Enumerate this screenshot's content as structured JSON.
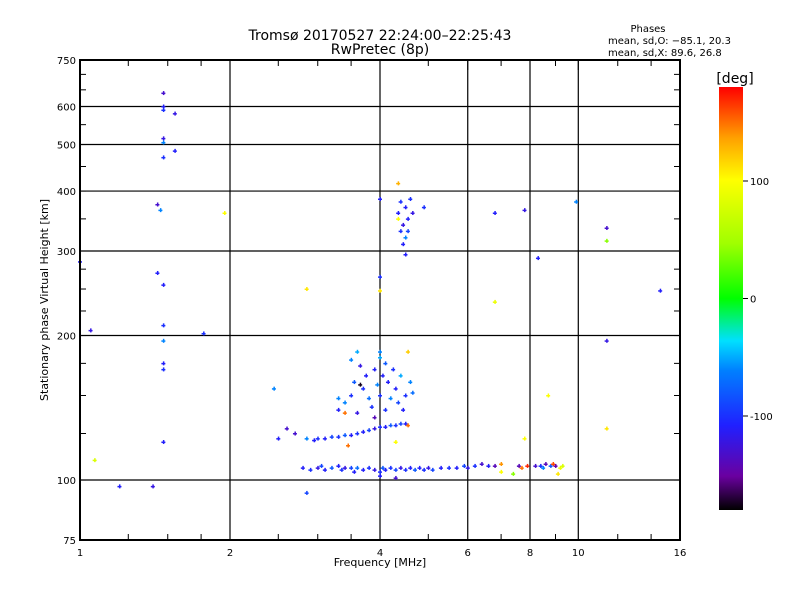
{
  "chart_data": {
    "type": "scatter",
    "title": "Tromsø 20170527 22:24:00–22:25:43",
    "subtitle": "RwPretec (8p)",
    "xlabel": "Frequency [MHz]",
    "ylabel": "Stationary phase Virtual Height [km]",
    "xscale": "log",
    "yscale": "log",
    "xlim": [
      1,
      16
    ],
    "ylim": [
      75,
      750
    ],
    "xticks": [
      1,
      2,
      4,
      6,
      8,
      10,
      16
    ],
    "xtick_labels": [
      "1",
      "2",
      "4",
      "6",
      "8",
      "10",
      "16"
    ],
    "yticks": [
      75,
      100,
      200,
      300,
      400,
      500,
      600,
      750
    ],
    "ytick_labels": [
      "75",
      "100",
      "200",
      "300",
      "400",
      "500",
      "600",
      "750"
    ],
    "grid": true,
    "colorbar": {
      "label": "[deg]",
      "range": [
        -180,
        180
      ],
      "ticks": [
        100,
        0,
        -100
      ],
      "tick_labels": [
        "100",
        "0",
        "-100"
      ]
    },
    "stats": {
      "title": "Phases",
      "o_line": "mean, sd,O: −85.1, 20.3",
      "x_line": "mean, sd,X:  89.6, 26.8"
    },
    "point_fields": [
      "frequency_mhz",
      "height_km",
      "phase_deg"
    ],
    "points": [
      [
        2.8,
        106,
        -110
      ],
      [
        2.9,
        105,
        -100
      ],
      [
        3.0,
        106,
        -120
      ],
      [
        3.05,
        107,
        -90
      ],
      [
        3.1,
        105,
        -110
      ],
      [
        3.2,
        106,
        -80
      ],
      [
        3.3,
        107,
        -110
      ],
      [
        3.35,
        105,
        -100
      ],
      [
        3.4,
        106,
        -120
      ],
      [
        3.5,
        106,
        -90
      ],
      [
        3.55,
        104,
        -110
      ],
      [
        3.6,
        106,
        -70
      ],
      [
        3.7,
        105,
        -110
      ],
      [
        3.8,
        106,
        -100
      ],
      [
        3.9,
        105,
        -120
      ],
      [
        4.0,
        104,
        -100
      ],
      [
        4.05,
        106,
        -80
      ],
      [
        4.1,
        105,
        -110
      ],
      [
        4.2,
        106,
        -100
      ],
      [
        4.3,
        105,
        -90
      ],
      [
        4.4,
        106,
        -120
      ],
      [
        4.5,
        105,
        -100
      ],
      [
        4.6,
        106,
        -110
      ],
      [
        4.7,
        105,
        -80
      ],
      [
        4.8,
        106,
        -110
      ],
      [
        4.9,
        105,
        -100
      ],
      [
        5.0,
        106,
        -120
      ],
      [
        5.1,
        105,
        -90
      ],
      [
        5.3,
        106,
        -110
      ],
      [
        5.5,
        106,
        -100
      ],
      [
        5.7,
        106,
        -110
      ],
      [
        5.9,
        107,
        -90
      ],
      [
        6.0,
        106,
        -120
      ],
      [
        6.2,
        107,
        -100
      ],
      [
        6.4,
        108,
        -130
      ],
      [
        6.6,
        107,
        -110
      ],
      [
        6.8,
        107,
        -140
      ],
      [
        7.0,
        108,
        140
      ],
      [
        7.6,
        107,
        -140
      ],
      [
        7.7,
        106,
        150
      ],
      [
        7.9,
        107,
        170
      ],
      [
        8.2,
        107,
        -130
      ],
      [
        8.4,
        107,
        -100
      ],
      [
        8.5,
        106,
        -60
      ],
      [
        8.6,
        108,
        -140
      ],
      [
        8.8,
        107,
        -80
      ],
      [
        8.9,
        108,
        160
      ],
      [
        9.0,
        107,
        -150
      ],
      [
        9.2,
        106,
        90
      ],
      [
        9.3,
        107,
        80
      ],
      [
        7.4,
        103,
        40
      ],
      [
        9.1,
        103,
        110
      ],
      [
        4.0,
        102,
        -110
      ],
      [
        4.3,
        101,
        -130
      ],
      [
        2.5,
        122,
        -110
      ],
      [
        2.6,
        128,
        -130
      ],
      [
        2.7,
        125,
        -130
      ],
      [
        2.85,
        122,
        -60
      ],
      [
        2.95,
        121,
        -110
      ],
      [
        3.0,
        122,
        -100
      ],
      [
        3.1,
        122,
        -110
      ],
      [
        3.2,
        123,
        -90
      ],
      [
        3.3,
        123,
        -100
      ],
      [
        3.4,
        124,
        -80
      ],
      [
        3.5,
        124,
        -110
      ],
      [
        3.6,
        125,
        -100
      ],
      [
        3.7,
        126,
        -110
      ],
      [
        3.8,
        127,
        -90
      ],
      [
        3.9,
        128,
        -120
      ],
      [
        4.0,
        129,
        -100
      ],
      [
        4.1,
        129,
        -110
      ],
      [
        4.2,
        130,
        -80
      ],
      [
        4.3,
        130,
        -100
      ],
      [
        4.4,
        131,
        -90
      ],
      [
        4.5,
        131,
        -110
      ],
      [
        4.55,
        130,
        150
      ],
      [
        3.45,
        118,
        150
      ],
      [
        3.3,
        140,
        -110
      ],
      [
        3.4,
        145,
        -60
      ],
      [
        3.5,
        150,
        -100
      ],
      [
        3.55,
        160,
        -80
      ],
      [
        3.6,
        138,
        -120
      ],
      [
        3.7,
        155,
        -100
      ],
      [
        3.75,
        165,
        -110
      ],
      [
        3.8,
        148,
        -70
      ],
      [
        3.85,
        142,
        -100
      ],
      [
        3.9,
        170,
        -110
      ],
      [
        3.95,
        158,
        -60
      ],
      [
        4.0,
        180,
        -50
      ],
      [
        4.0,
        150,
        -100
      ],
      [
        4.05,
        165,
        -110
      ],
      [
        4.1,
        175,
        -80
      ],
      [
        4.1,
        140,
        -100
      ],
      [
        4.15,
        160,
        -110
      ],
      [
        4.2,
        148,
        -60
      ],
      [
        4.25,
        170,
        -100
      ],
      [
        4.3,
        155,
        -110
      ],
      [
        4.35,
        145,
        -90
      ],
      [
        4.4,
        165,
        -50
      ],
      [
        4.45,
        140,
        -110
      ],
      [
        4.5,
        150,
        -100
      ],
      [
        4.55,
        185,
        120
      ],
      [
        4.6,
        160,
        -60
      ],
      [
        4.65,
        152,
        -70
      ],
      [
        3.65,
        173,
        -120
      ],
      [
        3.3,
        148,
        -60
      ],
      [
        3.65,
        158,
        -175
      ],
      [
        4.0,
        185,
        -60
      ],
      [
        3.5,
        178,
        -60
      ],
      [
        3.6,
        185,
        -50
      ],
      [
        3.4,
        138,
        150
      ],
      [
        3.9,
        135,
        -140
      ],
      [
        4.35,
        360,
        -110
      ],
      [
        4.4,
        380,
        -100
      ],
      [
        4.45,
        340,
        -120
      ],
      [
        4.5,
        370,
        -110
      ],
      [
        4.55,
        330,
        -90
      ],
      [
        4.6,
        385,
        -100
      ],
      [
        4.45,
        310,
        -110
      ],
      [
        4.5,
        320,
        -60
      ],
      [
        4.55,
        350,
        -110
      ],
      [
        4.4,
        330,
        -100
      ],
      [
        4.65,
        360,
        -120
      ],
      [
        4.5,
        295,
        -110
      ],
      [
        4.35,
        415,
        130
      ],
      [
        4.9,
        370,
        -100
      ],
      [
        4.0,
        385,
        -110
      ],
      [
        4.35,
        350,
        100
      ],
      [
        1.47,
        640,
        -130
      ],
      [
        1.47,
        600,
        -110
      ],
      [
        1.47,
        590,
        -100
      ],
      [
        1.47,
        515,
        -120
      ],
      [
        1.47,
        505,
        -60
      ],
      [
        1.47,
        470,
        -100
      ],
      [
        1.55,
        580,
        -120
      ],
      [
        1.55,
        485,
        -110
      ],
      [
        1.43,
        375,
        -130
      ],
      [
        1.45,
        365,
        -60
      ],
      [
        1.43,
        270,
        -110
      ],
      [
        1.47,
        255,
        -110
      ],
      [
        1.47,
        210,
        -100
      ],
      [
        1.47,
        195,
        -60
      ],
      [
        1.47,
        175,
        -110
      ],
      [
        1.47,
        170,
        -100
      ],
      [
        1.47,
        120,
        -110
      ],
      [
        1.4,
        97,
        -120
      ],
      [
        1.0,
        285,
        -110
      ],
      [
        1.05,
        205,
        -120
      ],
      [
        1.07,
        110,
        80
      ],
      [
        1.2,
        97,
        -110
      ],
      [
        1.77,
        202,
        -100
      ],
      [
        1.95,
        360,
        100
      ],
      [
        2.85,
        250,
        110
      ],
      [
        2.85,
        94,
        -90
      ],
      [
        4.0,
        265,
        -100
      ],
      [
        4.0,
        248,
        110
      ],
      [
        6.8,
        360,
        -110
      ],
      [
        6.8,
        235,
        90
      ],
      [
        7.8,
        365,
        -120
      ],
      [
        7.8,
        122,
        100
      ],
      [
        8.3,
        290,
        -110
      ],
      [
        9.9,
        380,
        -60
      ],
      [
        11.4,
        335,
        -130
      ],
      [
        11.4,
        315,
        40
      ],
      [
        11.4,
        195,
        -120
      ],
      [
        11.4,
        128,
        110
      ],
      [
        14.6,
        248,
        -110
      ],
      [
        8.7,
        150,
        100
      ],
      [
        2.45,
        155,
        -60
      ],
      [
        4.3,
        120,
        100
      ],
      [
        7.0,
        104,
        100
      ]
    ]
  }
}
